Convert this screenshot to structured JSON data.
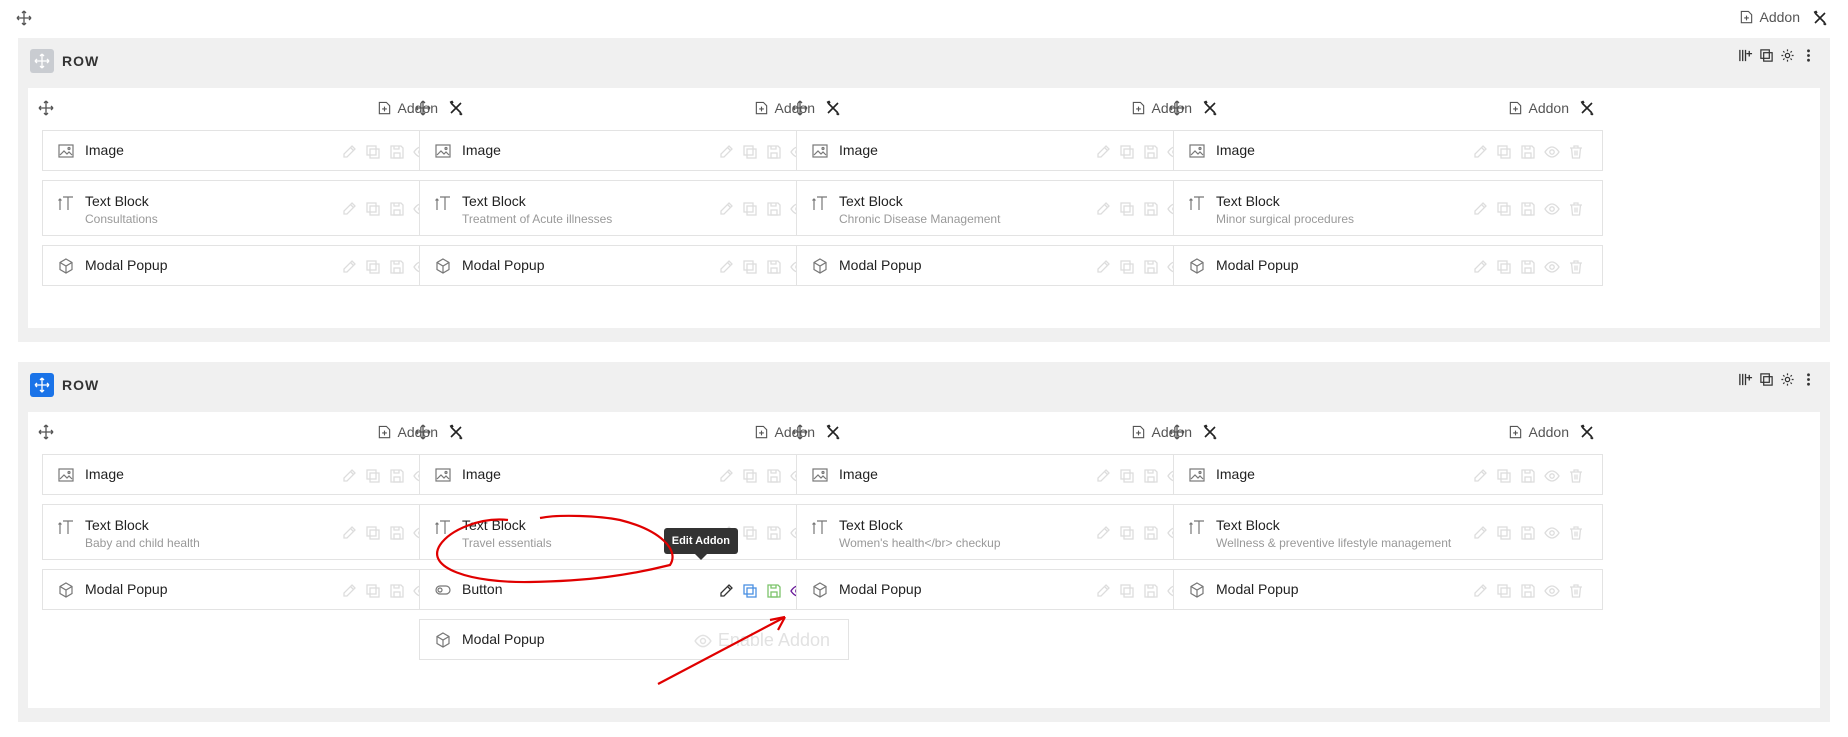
{
  "top": {
    "addon_label": "Addon"
  },
  "rows": [
    {
      "label": "ROW",
      "columns": [
        {
          "addon_label": "Addon",
          "addons": [
            {
              "type": "image",
              "title": "Image",
              "sub": ""
            },
            {
              "type": "text",
              "title": "Text Block",
              "sub": "Consultations"
            },
            {
              "type": "modal",
              "title": "Modal Popup",
              "sub": ""
            }
          ]
        },
        {
          "addon_label": "Addon",
          "addons": [
            {
              "type": "image",
              "title": "Image",
              "sub": ""
            },
            {
              "type": "text",
              "title": "Text Block",
              "sub": "Treatment of Acute illnesses"
            },
            {
              "type": "modal",
              "title": "Modal Popup",
              "sub": ""
            }
          ]
        },
        {
          "addon_label": "Addon",
          "addons": [
            {
              "type": "image",
              "title": "Image",
              "sub": ""
            },
            {
              "type": "text",
              "title": "Text Block",
              "sub": "Chronic Disease Management"
            },
            {
              "type": "modal",
              "title": "Modal Popup",
              "sub": ""
            }
          ]
        },
        {
          "addon_label": "Addon",
          "addons": [
            {
              "type": "image",
              "title": "Image",
              "sub": ""
            },
            {
              "type": "text",
              "title": "Text Block",
              "sub": "Minor surgical procedures"
            },
            {
              "type": "modal",
              "title": "Modal Popup",
              "sub": ""
            }
          ]
        }
      ]
    },
    {
      "label": "ROW",
      "columns": [
        {
          "addon_label": "Addon",
          "addons": [
            {
              "type": "image",
              "title": "Image",
              "sub": ""
            },
            {
              "type": "text",
              "title": "Text Block",
              "sub": "Baby and child health"
            },
            {
              "type": "modal",
              "title": "Modal Popup",
              "sub": ""
            }
          ]
        },
        {
          "addon_label": "Addon",
          "addons": [
            {
              "type": "image",
              "title": "Image",
              "sub": ""
            },
            {
              "type": "text",
              "title": "Text Block",
              "sub": "Travel essentials"
            },
            {
              "type": "button",
              "title": "Button",
              "sub": ""
            },
            {
              "type": "modal",
              "title": "Modal Popup",
              "sub": ""
            }
          ]
        },
        {
          "addon_label": "Addon",
          "addons": [
            {
              "type": "image",
              "title": "Image",
              "sub": ""
            },
            {
              "type": "text",
              "title": "Text Block",
              "sub": "Women's health</br> checkup"
            },
            {
              "type": "modal",
              "title": "Modal Popup",
              "sub": ""
            }
          ]
        },
        {
          "addon_label": "Addon",
          "addons": [
            {
              "type": "image",
              "title": "Image",
              "sub": ""
            },
            {
              "type": "text",
              "title": "Text Block",
              "sub": "Wellness & preventive lifestyle management"
            },
            {
              "type": "modal",
              "title": "Modal Popup",
              "sub": ""
            }
          ]
        }
      ]
    }
  ],
  "tooltip": {
    "label": "Edit Addon"
  },
  "enable_addon": {
    "label": "Enable Addon"
  },
  "colors": {
    "blue": "#1a73e8",
    "edit": "#333333",
    "duplicate": "#4a90e2",
    "save": "#7cc46b",
    "view": "#6a1b9a",
    "delete": "#e05555",
    "annotation": "#e00000"
  }
}
